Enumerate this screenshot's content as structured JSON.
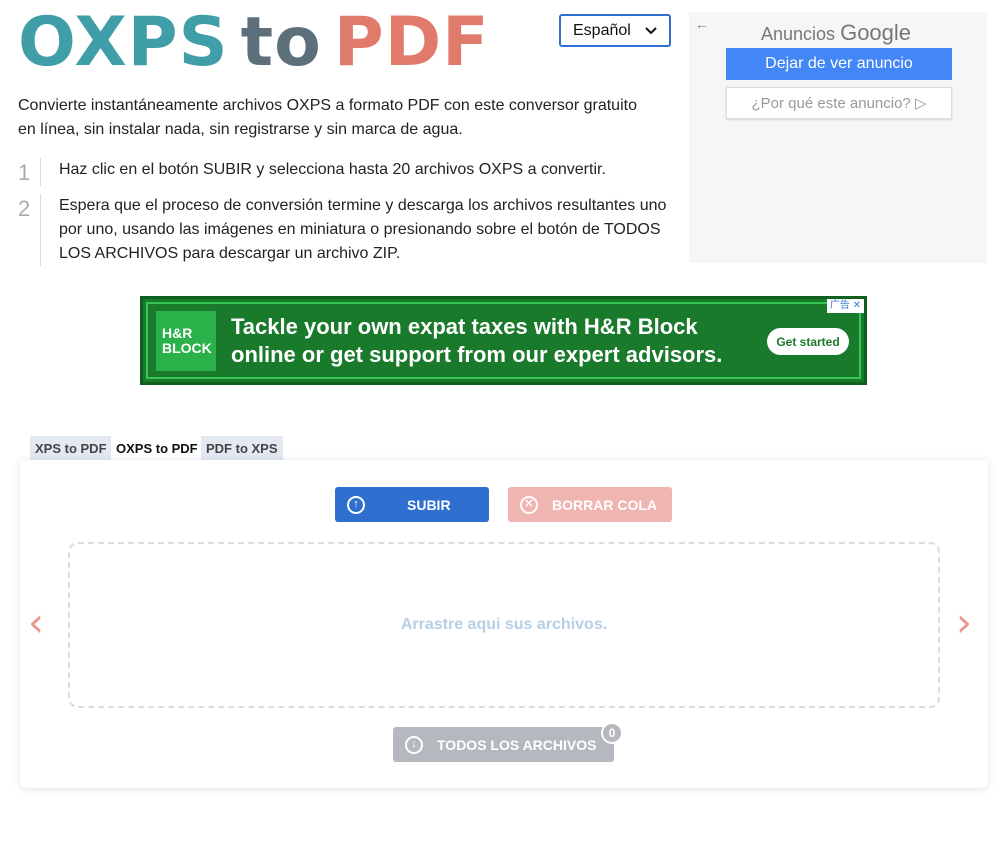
{
  "logo": {
    "part1": "OXPS",
    "part2": "to",
    "part3": "PDF"
  },
  "language": {
    "selected": "Español"
  },
  "google_ad": {
    "header_prefix": "Anuncios",
    "header_brand": "Google",
    "stop_label": "Dejar de ver anuncio",
    "why_label": "¿Por qué este anuncio? ▷"
  },
  "intro": "Convierte instantáneamente archivos OXPS a formato PDF con este conversor gratuito en línea, sin instalar nada, sin registrarse y sin marca de agua.",
  "steps": [
    {
      "num": "1",
      "text": "Haz clic en el botón SUBIR y selecciona hasta 20 archivos OXPS a convertir."
    },
    {
      "num": "2",
      "text": "Espera que el proceso de conversión termine y descarga los archivos resultantes uno por uno, usando las imágenes en miniatura o presionando sobre el botón de TODOS LOS ARCHIVOS para descargar un archivo ZIP."
    }
  ],
  "banner": {
    "brand_line1": "H&R",
    "brand_line2": "BLOCK",
    "headline_line1": "Tackle your own expat taxes with H&R Block",
    "headline_line2": "online or get support from our expert advisors.",
    "cta": "Get started",
    "ad_tag": "广告"
  },
  "tabs": [
    {
      "label": "XPS to PDF",
      "active": false
    },
    {
      "label": "OXPS to PDF",
      "active": true
    },
    {
      "label": "PDF to XPS",
      "active": false
    }
  ],
  "converter": {
    "upload_label": "SUBIR",
    "clear_label": "BORRAR COLA",
    "drop_text": "Arrastre aqui sus archivos.",
    "all_files_label": "TODOS LOS ARCHIVOS",
    "file_count": "0"
  },
  "colors": {
    "accent_blue": "#2f6fcf",
    "logo_teal": "#3f9ea8",
    "logo_gray": "#5e6f7c",
    "logo_coral": "#e07b6c",
    "banner_green": "#1a7a2c"
  }
}
